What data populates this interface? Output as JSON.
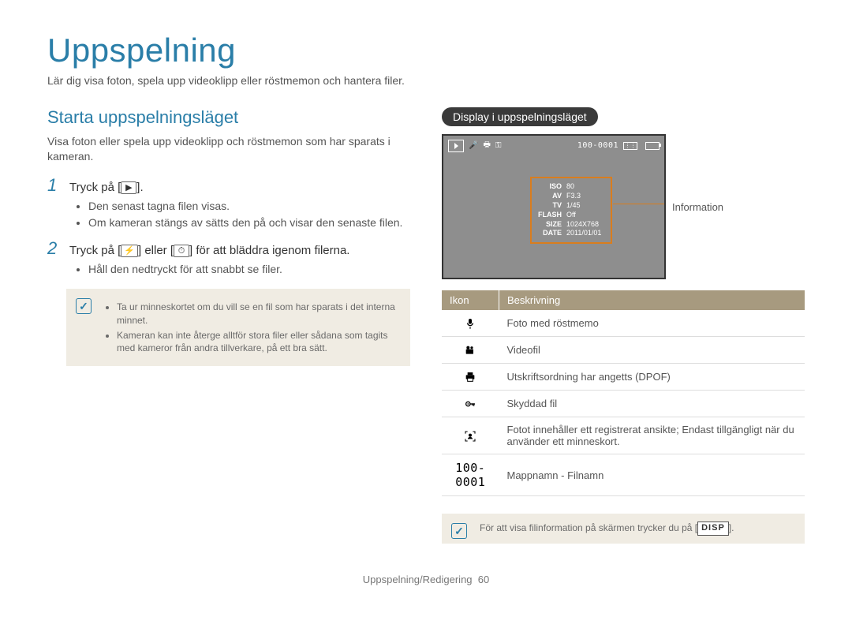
{
  "title": "Uppspelning",
  "intro": "Lär dig visa foton, spela upp videoklipp eller röstmemon och hantera filer.",
  "left": {
    "subhead": "Starta uppspelningsläget",
    "para": "Visa foton eller spela upp videoklipp och röstmemon som har sparats i kameran.",
    "step1": {
      "num": "1",
      "pre": "Tryck på [",
      "key": "▶",
      "post": "]."
    },
    "step1_bullets": [
      "Den senast tagna filen visas.",
      "Om kameran stängs av sätts den på och visar den senaste filen."
    ],
    "step2": {
      "num": "2",
      "pre": "Tryck på [",
      "key1": "⚡",
      "mid": "] eller [",
      "key2": "⏱",
      "post": "] för att bläddra igenom filerna."
    },
    "step2_bullets": [
      "Håll den nedtryckt för att snabbt se filer."
    ],
    "note_items": [
      "Ta ur minneskortet om du vill se en fil som har sparats i det interna minnet.",
      "Kameran kan inte återge alltför stora filer eller sådana som tagits med kameror från andra tillverkare, på ett bra sätt."
    ]
  },
  "right": {
    "pill": "Display i uppspelningsläget",
    "lcd": {
      "filecode": "100-0001",
      "info_title": "Information",
      "rows": [
        [
          "ISO",
          "80"
        ],
        [
          "AV",
          "F3.3"
        ],
        [
          "TV",
          "1/45"
        ],
        [
          "FLASH",
          "Off"
        ],
        [
          "SIZE",
          "1024X768"
        ],
        [
          "DATE",
          "2011/01/01"
        ]
      ]
    },
    "table": {
      "head_icon": "Ikon",
      "head_desc": "Beskrivning",
      "rows": [
        {
          "icon": "mic",
          "desc": "Foto med röstmemo"
        },
        {
          "icon": "video",
          "desc": "Videofil"
        },
        {
          "icon": "print",
          "desc": "Utskriftsordning har angetts (DPOF)"
        },
        {
          "icon": "lock",
          "desc": "Skyddad fil"
        },
        {
          "icon": "face",
          "desc": "Fotot innehåller ett registrerat ansikte; Endast tillgängligt när du använder ett minneskort."
        },
        {
          "icon": "code",
          "code": "100-0001",
          "desc": "Mappnamn - Filnamn"
        }
      ]
    },
    "footnote_pre": "För att visa filinformation på skärmen trycker du på [",
    "footnote_disp": "DISP",
    "footnote_post": "]."
  },
  "footer": {
    "section": "Uppspelning/Redigering",
    "page": "60"
  }
}
